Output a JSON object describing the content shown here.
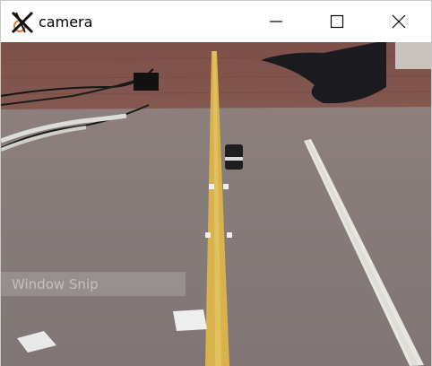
{
  "window": {
    "title": "camera",
    "controls": {
      "minimize_icon": "minimize-icon",
      "maximize_icon": "maximize-icon",
      "close_icon": "close-icon"
    }
  },
  "feed": {
    "overlay_text": "Window Snip"
  },
  "colors": {
    "floor_wood": "#8f6f63",
    "board_gray": "#877c7c",
    "tape_yellow": "#d8b24a",
    "ruler_white": "#e8e6e0"
  }
}
